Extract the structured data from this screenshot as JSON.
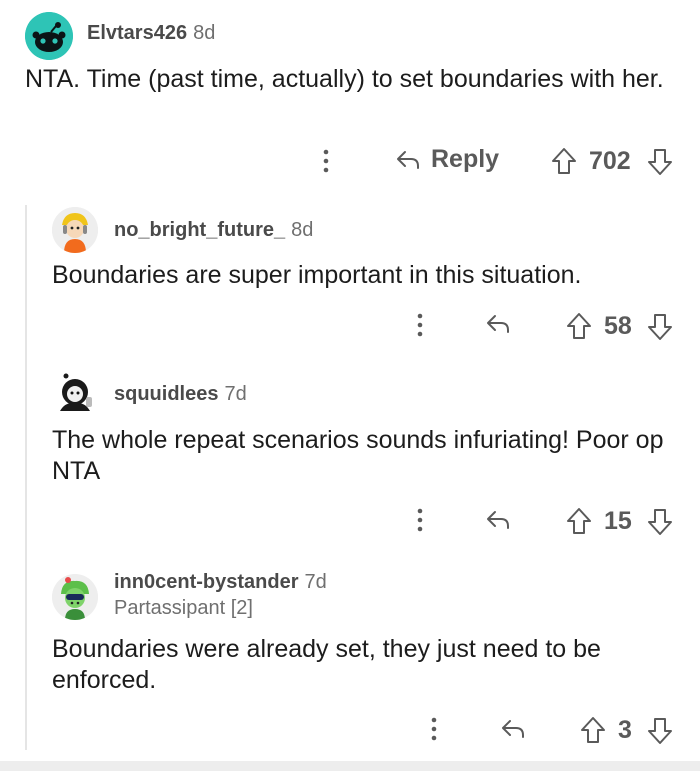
{
  "comments": [
    {
      "username": "Elvtars426",
      "age": "8d",
      "flair": "",
      "text": "NTA. Time (past time, actually) to set boundaries with her.",
      "reply_label": "Reply",
      "votes": "702"
    },
    {
      "username": "no_bright_future_",
      "age": "8d",
      "flair": "",
      "text": "Boundaries are super important in this situation.",
      "reply_label": "",
      "votes": "58"
    },
    {
      "username": "squuidlees",
      "age": "7d",
      "flair": "",
      "text": "The whole repeat scenarios sounds infuriating! Poor op NTA",
      "reply_label": "",
      "votes": "15"
    },
    {
      "username": "inn0cent-bystander",
      "age": "7d",
      "flair": "Partassipant [2]",
      "text": "Boundaries were already set, they just need to be enforced.",
      "reply_label": "",
      "votes": "3"
    }
  ],
  "colors": {
    "avatar_teal": "#2ec4b6",
    "avatar_orange": "#f26b1d",
    "avatar_green": "#5cbf4a",
    "text": "#1c1c1c",
    "muted": "#6f6f6f"
  },
  "icons": [
    "more-vertical-icon",
    "reply-arrow-icon",
    "upvote-arrow-icon",
    "downvote-arrow-icon"
  ]
}
